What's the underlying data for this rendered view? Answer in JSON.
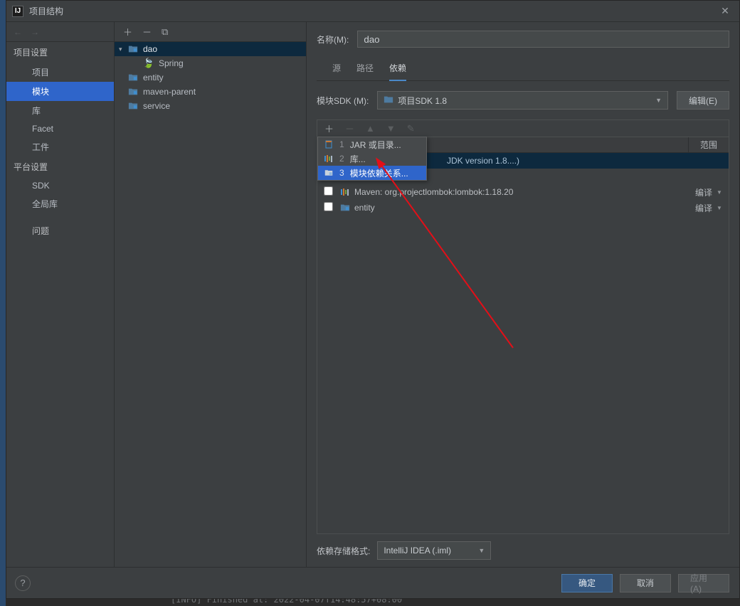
{
  "window": {
    "title": "项目结构"
  },
  "left": {
    "section1": "项目设置",
    "items1": [
      "项目",
      "模块",
      "库",
      "Facet",
      "工件"
    ],
    "selected1": "模块",
    "section2": "平台设置",
    "items2": [
      "SDK",
      "全局库"
    ],
    "section3": "问题"
  },
  "tree": [
    {
      "label": "dao",
      "type": "module",
      "depth": 0,
      "expanded": true,
      "selected": true
    },
    {
      "label": "Spring",
      "type": "leaf",
      "depth": 1
    },
    {
      "label": "entity",
      "type": "module",
      "depth": 0
    },
    {
      "label": "maven-parent",
      "type": "module",
      "depth": 0
    },
    {
      "label": "service",
      "type": "module",
      "depth": 0
    }
  ],
  "details": {
    "name_label": "名称(M):",
    "name_value": "dao",
    "tabs": [
      "源",
      "路径",
      "依赖"
    ],
    "active_tab": "依赖",
    "sdk_label": "模块SDK (M):",
    "sdk_value": "项目SDK 1.8",
    "edit_label": "编辑(E)",
    "popup": {
      "items": [
        {
          "n": "1",
          "label": "JAR 或目录...",
          "icon": "jar"
        },
        {
          "n": "2",
          "label": "库...",
          "icon": "bars"
        },
        {
          "n": "3",
          "label": "模块依赖关系...",
          "icon": "folder",
          "hl": true
        }
      ]
    },
    "dep_header_scope": "范围",
    "deps": [
      {
        "hidden": true,
        "label": "JDK version 1.8....)",
        "selected": true
      },
      {
        "hidden_under_popup": true
      },
      {
        "cb": false,
        "icon": "bars",
        "label": "Maven: org.projectlombok:lombok:1.18.20",
        "scope": "编译"
      },
      {
        "cb": false,
        "icon": "folder",
        "label": "entity",
        "scope": "编译"
      }
    ],
    "storage_label": "依赖存储格式:",
    "storage_value": "IntelliJ IDEA (.iml)"
  },
  "footer": {
    "ok": "确定",
    "cancel": "取消",
    "apply": "应用(A)"
  },
  "terminal_line": "[INFO] Finished at: 2022-04-07T14:48:57+08:00"
}
